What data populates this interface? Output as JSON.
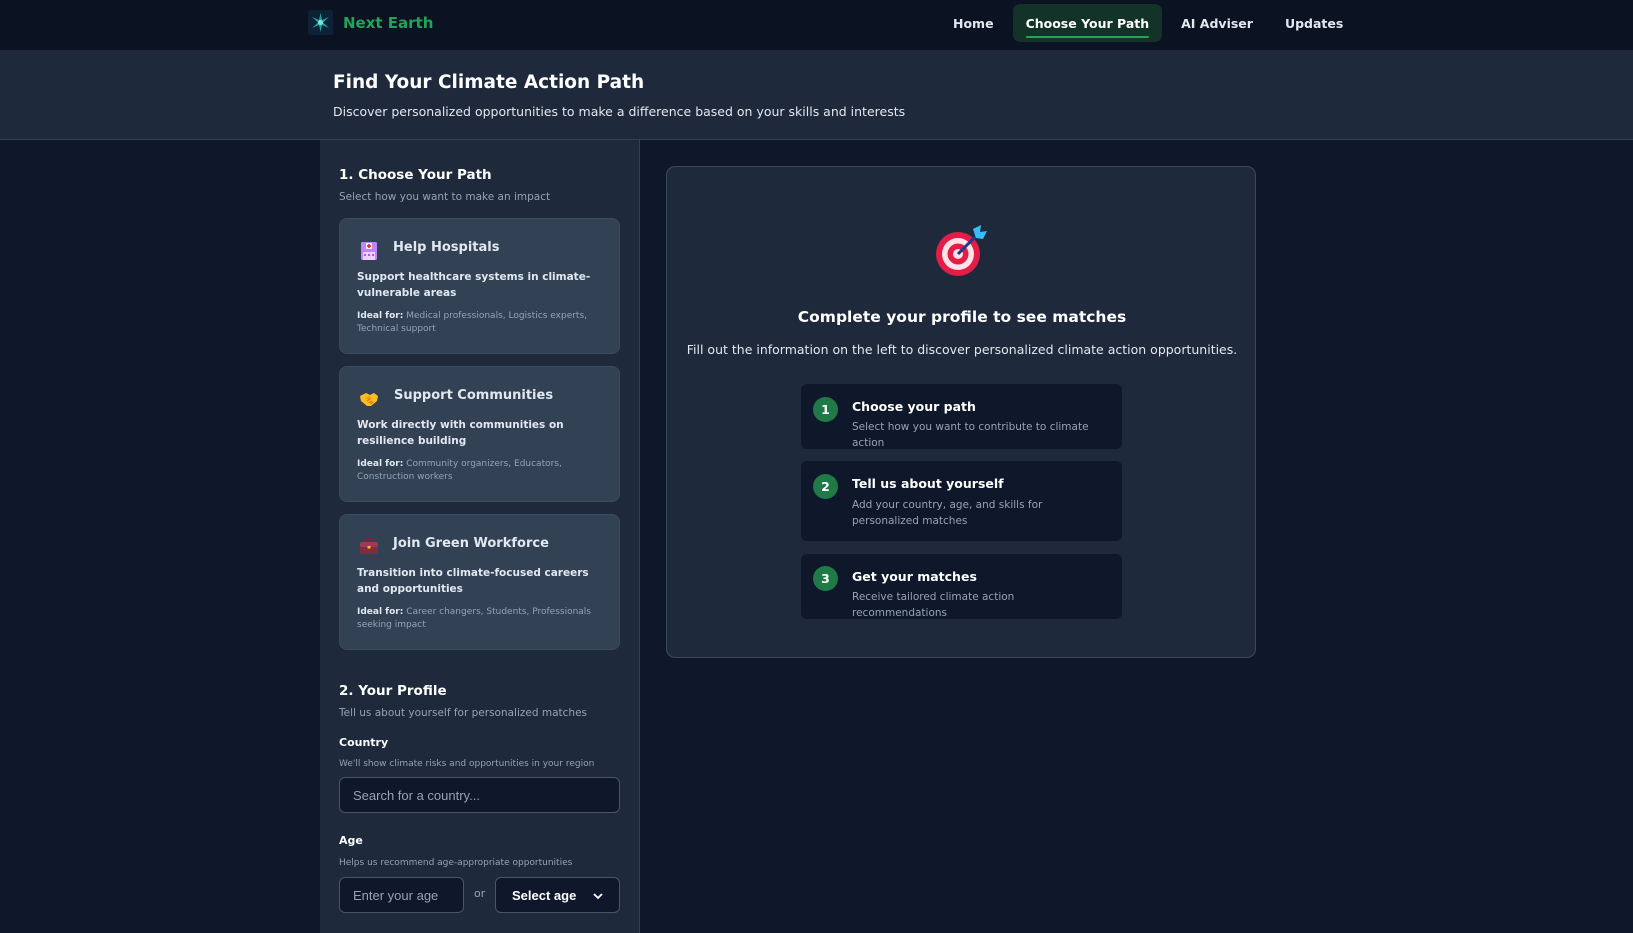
{
  "nav": {
    "brand": "Next Earth",
    "links": [
      {
        "label": "Home",
        "active": false
      },
      {
        "label": "Choose Your Path",
        "active": true
      },
      {
        "label": "AI Adviser",
        "active": false
      },
      {
        "label": "Updates",
        "active": false
      }
    ]
  },
  "hero": {
    "title": "Find Your Climate Action Path",
    "subtitle": "Discover personalized opportunities to make a difference based on your skills and interests"
  },
  "sidebar": {
    "section1": {
      "title": "1. Choose Your Path",
      "subtitle": "Select how you want to make an impact"
    },
    "paths": [
      {
        "icon": "hospital-icon",
        "title": "Help Hospitals",
        "description": "Support healthcare systems in climate-vulnerable areas",
        "ideal_label": "Ideal for:",
        "ideal": "Medical professionals, Logistics experts, Technical support"
      },
      {
        "icon": "handshake-icon",
        "title": "Support Communities",
        "description": "Work directly with communities on resilience building",
        "ideal_label": "Ideal for:",
        "ideal": "Community organizers, Educators, Construction workers"
      },
      {
        "icon": "briefcase-icon",
        "title": "Join Green Workforce",
        "description": "Transition into climate-focused careers and opportunities",
        "ideal_label": "Ideal for:",
        "ideal": "Career changers, Students, Professionals seeking impact"
      }
    ],
    "section2": {
      "title": "2. Your Profile",
      "subtitle": "Tell us about yourself for personalized matches"
    },
    "country": {
      "label": "Country",
      "hint": "We'll show climate risks and opportunities in your region",
      "placeholder": "Search for a country..."
    },
    "age": {
      "label": "Age",
      "hint": "Helps us recommend age-appropriate opportunities",
      "placeholder": "Enter your age",
      "or": "or",
      "select_label": "Select age"
    }
  },
  "main": {
    "icon": "target-icon",
    "title": "Complete your profile to see matches",
    "subtitle": "Fill out the information on the left to discover personalized climate action opportunities.",
    "steps": [
      {
        "num": "1",
        "title": "Choose your path",
        "desc": "Select how you want to contribute to climate action"
      },
      {
        "num": "2",
        "title": "Tell us about yourself",
        "desc": "Add your country, age, and skills for personalized matches"
      },
      {
        "num": "3",
        "title": "Get your matches",
        "desc": "Receive tailored climate action recommendations"
      }
    ]
  },
  "colors": {
    "accent": "#22a35a",
    "step_badge": "#1f7a47",
    "background": "#0f172a",
    "panel": "#1e293b",
    "card": "#334155"
  }
}
